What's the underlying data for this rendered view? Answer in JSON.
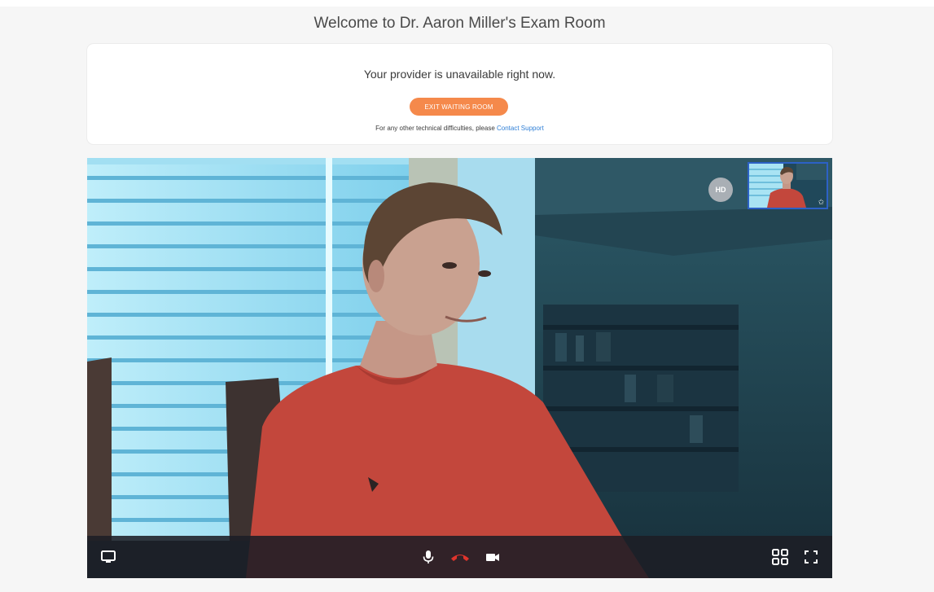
{
  "page": {
    "title": "Welcome to Dr. Aaron Miller's Exam Room"
  },
  "status_card": {
    "message": "Your provider is unavailable right now.",
    "exit_button_label": "EXIT WAITING ROOM",
    "support_prefix": "For any other technical difficulties, please ",
    "support_link_label": "Contact Support"
  },
  "video": {
    "hd_badge": "HD",
    "self_view_favorite_icon": "star-icon"
  },
  "controls": {
    "left": [
      "screen-share-icon"
    ],
    "center": [
      "microphone-icon",
      "hang-up-icon",
      "camera-icon"
    ],
    "right": [
      "grid-layout-icon",
      "fullscreen-icon"
    ]
  },
  "colors": {
    "accent_orange": "#f5894b",
    "link_blue": "#2f7fd6",
    "hang_up_red": "#e0342c",
    "self_view_border": "#2c61c6"
  }
}
